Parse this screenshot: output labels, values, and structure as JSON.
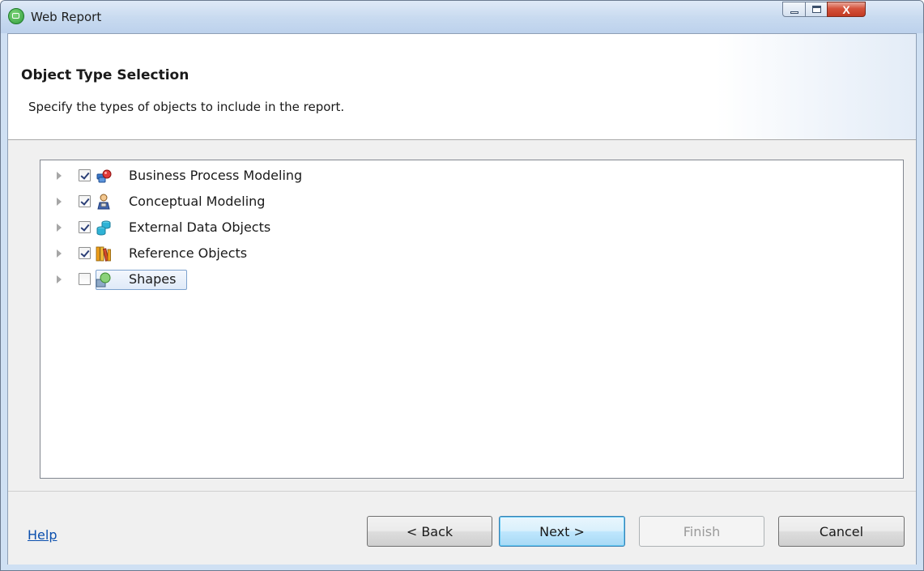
{
  "window": {
    "title": "Web Report",
    "close_glyph": "X"
  },
  "header": {
    "title": "Object Type Selection",
    "description": "Specify the types of objects to include in the report."
  },
  "tree": {
    "items": [
      {
        "label": "Business Process Modeling",
        "checked": true,
        "icon": "business-process-icon"
      },
      {
        "label": "Conceptual Modeling",
        "checked": true,
        "icon": "conceptual-modeling-icon"
      },
      {
        "label": "External Data Objects",
        "checked": true,
        "icon": "external-data-icon"
      },
      {
        "label": "Reference Objects",
        "checked": true,
        "icon": "reference-objects-icon"
      },
      {
        "label": "Shapes",
        "checked": false,
        "icon": "shapes-icon",
        "selected": true
      }
    ]
  },
  "footer": {
    "help_label": "Help",
    "back_label": "< Back",
    "next_label": "Next >",
    "finish_label": "Finish",
    "cancel_label": "Cancel"
  }
}
